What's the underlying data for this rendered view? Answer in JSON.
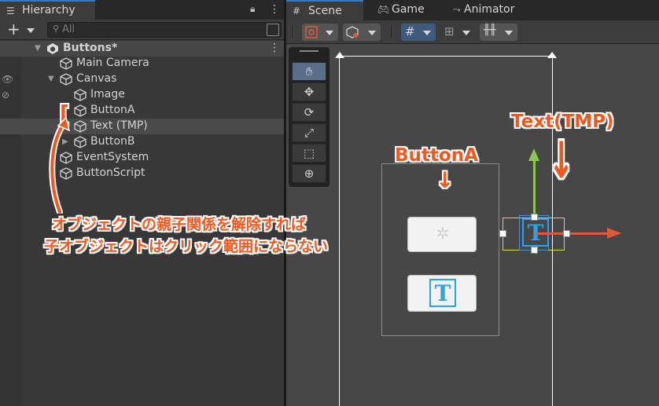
{
  "hierarchy": {
    "tab_label": "Hierarchy",
    "tab_icon": "list-icon",
    "search_placeholder": "All",
    "add_label": "+",
    "items": [
      {
        "label": "Buttons*",
        "kind": "scene"
      },
      {
        "label": "Main Camera",
        "kind": "object"
      },
      {
        "label": "Canvas",
        "kind": "object"
      },
      {
        "label": "Image",
        "kind": "object"
      },
      {
        "label": "ButtonA",
        "kind": "object"
      },
      {
        "label": "Text (TMP)",
        "kind": "object",
        "selected": true
      },
      {
        "label": "ButtonB",
        "kind": "object"
      },
      {
        "label": "EventSystem",
        "kind": "object"
      },
      {
        "label": "ButtonScript",
        "kind": "object"
      }
    ]
  },
  "scene_view": {
    "tabs": [
      {
        "label": "Scene",
        "icon": "grid-icon",
        "active": true
      },
      {
        "label": "Game",
        "icon": "gamepad-icon"
      },
      {
        "label": "Animator",
        "icon": "animator-icon"
      }
    ],
    "tools": [
      "hand-tool-icon",
      "move-tool-icon",
      "rotate-tool-icon",
      "scale-tool-icon",
      "rect-tool-icon",
      "transform-tool-icon"
    ],
    "tmp_glyph": "T",
    "accent_colors": {
      "y_axis": "#8ac94e",
      "x_axis": "#e05a3a",
      "tmp_blue": "#2aa3e8",
      "selection": "#e5d43a"
    }
  },
  "annotations": {
    "label_text_tmp": "Text(TMP)",
    "label_button_a": "ButtonA",
    "down_arrow": "↓",
    "bracket": "[",
    "note_line1": "オブジェクトの親子関係を解除すれば",
    "note_line2": "子オブジェクトはクリック範囲にならない",
    "color": "#f0581f"
  }
}
